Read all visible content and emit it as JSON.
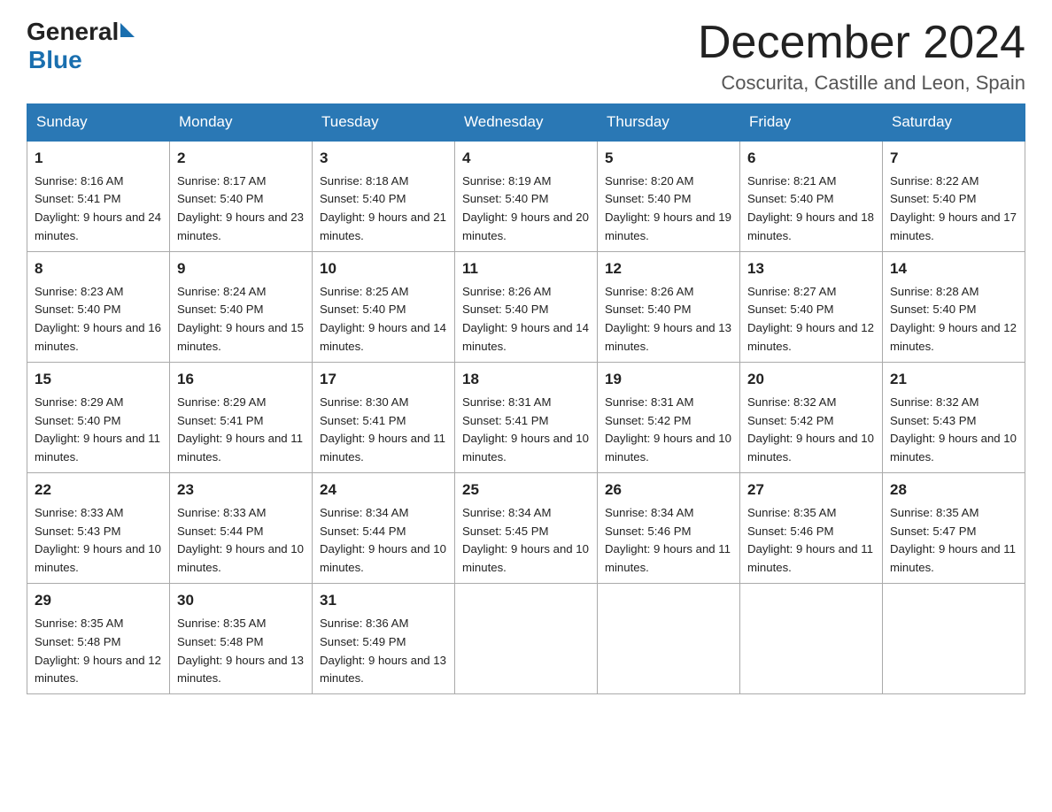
{
  "header": {
    "logo_general": "General",
    "logo_blue": "Blue",
    "month_title": "December 2024",
    "location": "Coscurita, Castille and Leon, Spain"
  },
  "weekdays": [
    "Sunday",
    "Monday",
    "Tuesday",
    "Wednesday",
    "Thursday",
    "Friday",
    "Saturday"
  ],
  "weeks": [
    [
      {
        "day": "1",
        "sunrise": "8:16 AM",
        "sunset": "5:41 PM",
        "daylight": "9 hours and 24 minutes."
      },
      {
        "day": "2",
        "sunrise": "8:17 AM",
        "sunset": "5:40 PM",
        "daylight": "9 hours and 23 minutes."
      },
      {
        "day": "3",
        "sunrise": "8:18 AM",
        "sunset": "5:40 PM",
        "daylight": "9 hours and 21 minutes."
      },
      {
        "day": "4",
        "sunrise": "8:19 AM",
        "sunset": "5:40 PM",
        "daylight": "9 hours and 20 minutes."
      },
      {
        "day": "5",
        "sunrise": "8:20 AM",
        "sunset": "5:40 PM",
        "daylight": "9 hours and 19 minutes."
      },
      {
        "day": "6",
        "sunrise": "8:21 AM",
        "sunset": "5:40 PM",
        "daylight": "9 hours and 18 minutes."
      },
      {
        "day": "7",
        "sunrise": "8:22 AM",
        "sunset": "5:40 PM",
        "daylight": "9 hours and 17 minutes."
      }
    ],
    [
      {
        "day": "8",
        "sunrise": "8:23 AM",
        "sunset": "5:40 PM",
        "daylight": "9 hours and 16 minutes."
      },
      {
        "day": "9",
        "sunrise": "8:24 AM",
        "sunset": "5:40 PM",
        "daylight": "9 hours and 15 minutes."
      },
      {
        "day": "10",
        "sunrise": "8:25 AM",
        "sunset": "5:40 PM",
        "daylight": "9 hours and 14 minutes."
      },
      {
        "day": "11",
        "sunrise": "8:26 AM",
        "sunset": "5:40 PM",
        "daylight": "9 hours and 14 minutes."
      },
      {
        "day": "12",
        "sunrise": "8:26 AM",
        "sunset": "5:40 PM",
        "daylight": "9 hours and 13 minutes."
      },
      {
        "day": "13",
        "sunrise": "8:27 AM",
        "sunset": "5:40 PM",
        "daylight": "9 hours and 12 minutes."
      },
      {
        "day": "14",
        "sunrise": "8:28 AM",
        "sunset": "5:40 PM",
        "daylight": "9 hours and 12 minutes."
      }
    ],
    [
      {
        "day": "15",
        "sunrise": "8:29 AM",
        "sunset": "5:40 PM",
        "daylight": "9 hours and 11 minutes."
      },
      {
        "day": "16",
        "sunrise": "8:29 AM",
        "sunset": "5:41 PM",
        "daylight": "9 hours and 11 minutes."
      },
      {
        "day": "17",
        "sunrise": "8:30 AM",
        "sunset": "5:41 PM",
        "daylight": "9 hours and 11 minutes."
      },
      {
        "day": "18",
        "sunrise": "8:31 AM",
        "sunset": "5:41 PM",
        "daylight": "9 hours and 10 minutes."
      },
      {
        "day": "19",
        "sunrise": "8:31 AM",
        "sunset": "5:42 PM",
        "daylight": "9 hours and 10 minutes."
      },
      {
        "day": "20",
        "sunrise": "8:32 AM",
        "sunset": "5:42 PM",
        "daylight": "9 hours and 10 minutes."
      },
      {
        "day": "21",
        "sunrise": "8:32 AM",
        "sunset": "5:43 PM",
        "daylight": "9 hours and 10 minutes."
      }
    ],
    [
      {
        "day": "22",
        "sunrise": "8:33 AM",
        "sunset": "5:43 PM",
        "daylight": "9 hours and 10 minutes."
      },
      {
        "day": "23",
        "sunrise": "8:33 AM",
        "sunset": "5:44 PM",
        "daylight": "9 hours and 10 minutes."
      },
      {
        "day": "24",
        "sunrise": "8:34 AM",
        "sunset": "5:44 PM",
        "daylight": "9 hours and 10 minutes."
      },
      {
        "day": "25",
        "sunrise": "8:34 AM",
        "sunset": "5:45 PM",
        "daylight": "9 hours and 10 minutes."
      },
      {
        "day": "26",
        "sunrise": "8:34 AM",
        "sunset": "5:46 PM",
        "daylight": "9 hours and 11 minutes."
      },
      {
        "day": "27",
        "sunrise": "8:35 AM",
        "sunset": "5:46 PM",
        "daylight": "9 hours and 11 minutes."
      },
      {
        "day": "28",
        "sunrise": "8:35 AM",
        "sunset": "5:47 PM",
        "daylight": "9 hours and 11 minutes."
      }
    ],
    [
      {
        "day": "29",
        "sunrise": "8:35 AM",
        "sunset": "5:48 PM",
        "daylight": "9 hours and 12 minutes."
      },
      {
        "day": "30",
        "sunrise": "8:35 AM",
        "sunset": "5:48 PM",
        "daylight": "9 hours and 13 minutes."
      },
      {
        "day": "31",
        "sunrise": "8:36 AM",
        "sunset": "5:49 PM",
        "daylight": "9 hours and 13 minutes."
      },
      null,
      null,
      null,
      null
    ]
  ],
  "labels": {
    "sunrise": "Sunrise:",
    "sunset": "Sunset:",
    "daylight": "Daylight:"
  }
}
